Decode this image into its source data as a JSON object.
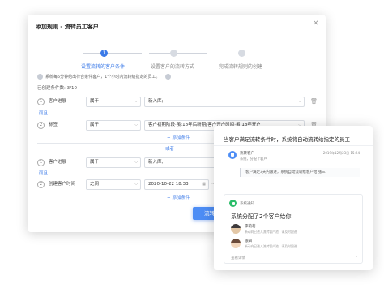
{
  "dialog": {
    "title": "添加规则 - 流转员工客户",
    "close_icon": "close-icon",
    "steps": [
      {
        "index": "1",
        "label": "设置流转的客户条件",
        "active": true
      },
      {
        "index": "2",
        "label": "设置客户的流转方式",
        "active": false
      },
      {
        "index": "3",
        "label": "完成流转规则的创建",
        "active": false
      }
    ],
    "notice": "系统每5分钟给出符合条件客户，1个小时内流转给指定的员工。",
    "created_count": "已创建条件数: 3/10",
    "group1": {
      "rows": [
        {
          "num": "1",
          "label": "客户进展",
          "op": "属于",
          "value": "新入库;"
        },
        {
          "num": "2",
          "label": "标签",
          "op": "属于",
          "value": "客户初期阶段·虽:18年后新期[客户开户时间·虽:18年开户"
        }
      ],
      "or_link": "而且",
      "add_link": "+ 添加条件"
    },
    "or_label": "或者",
    "group2": {
      "rows": [
        {
          "num": "1",
          "label": "客户进展",
          "op": "属于",
          "value": "新入库;"
        },
        {
          "num": "2",
          "label": "创建客户时间",
          "op": "之间",
          "value": "2020-10-22 18:33",
          "value2": "2020-10-..."
        }
      ],
      "and_link": "而且",
      "add_link": "+ 添加条件"
    },
    "submit_button": "流转记录"
  },
  "popup": {
    "title": "当客户满足流转条件时，系统将自动流转给指定的员工",
    "message": {
      "sender": "流转客户",
      "sub": "系统，分配了客户",
      "time": "2019年12月23日 15:24",
      "quote": "客户满足3天内跟进，系统自动流转给客户给 张三"
    },
    "card": {
      "sender": "系统通知",
      "title": "系统分配了2个客户给你",
      "customers": [
        {
          "name": "李莉莉",
          "desc": "新动向已进入流转客户池，请及时跟进"
        },
        {
          "name": "张四",
          "desc": "新动向已进入流转客户池，请及时跟进"
        }
      ],
      "footer": "查看详情"
    }
  }
}
